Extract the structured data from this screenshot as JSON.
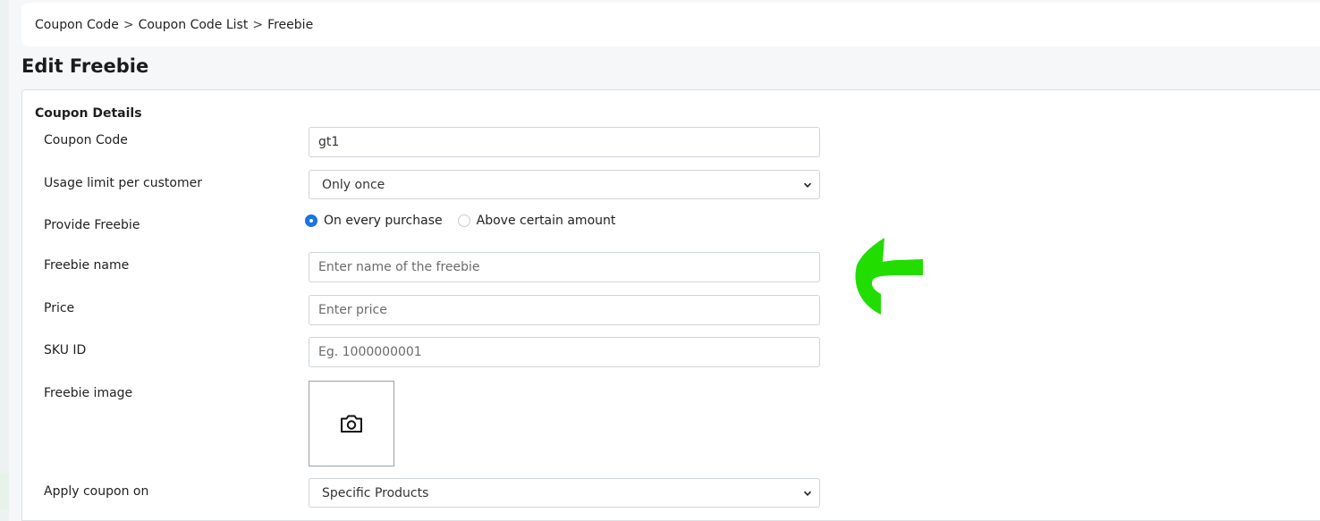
{
  "breadcrumb": {
    "items": [
      "Coupon Code",
      "Coupon Code List",
      "Freebie"
    ],
    "separator": ">"
  },
  "page": {
    "title": "Edit Freebie"
  },
  "form": {
    "section_title": "Coupon Details",
    "coupon_code": {
      "label": "Coupon Code",
      "value": "gt1"
    },
    "usage_limit": {
      "label": "Usage limit per customer",
      "selected": "Only once"
    },
    "provide_freebie": {
      "label": "Provide Freebie",
      "options": [
        "On every purchase",
        "Above certain amount"
      ],
      "selected": "On every purchase"
    },
    "freebie_name": {
      "label": "Freebie name",
      "placeholder": "Enter name of the freebie"
    },
    "price": {
      "label": "Price",
      "placeholder": "Enter price"
    },
    "sku": {
      "label": "SKU ID",
      "placeholder": "Eg. 1000000001"
    },
    "freebie_image": {
      "label": "Freebie image",
      "icon": "camera-icon"
    },
    "apply_on": {
      "label": "Apply coupon on",
      "selected": "Specific Products"
    }
  },
  "annotation": {
    "icon": "arrow-left-annotation",
    "color": "#22dd00"
  },
  "colors": {
    "accent": "#1a73e8",
    "annotation": "#22dd00"
  }
}
